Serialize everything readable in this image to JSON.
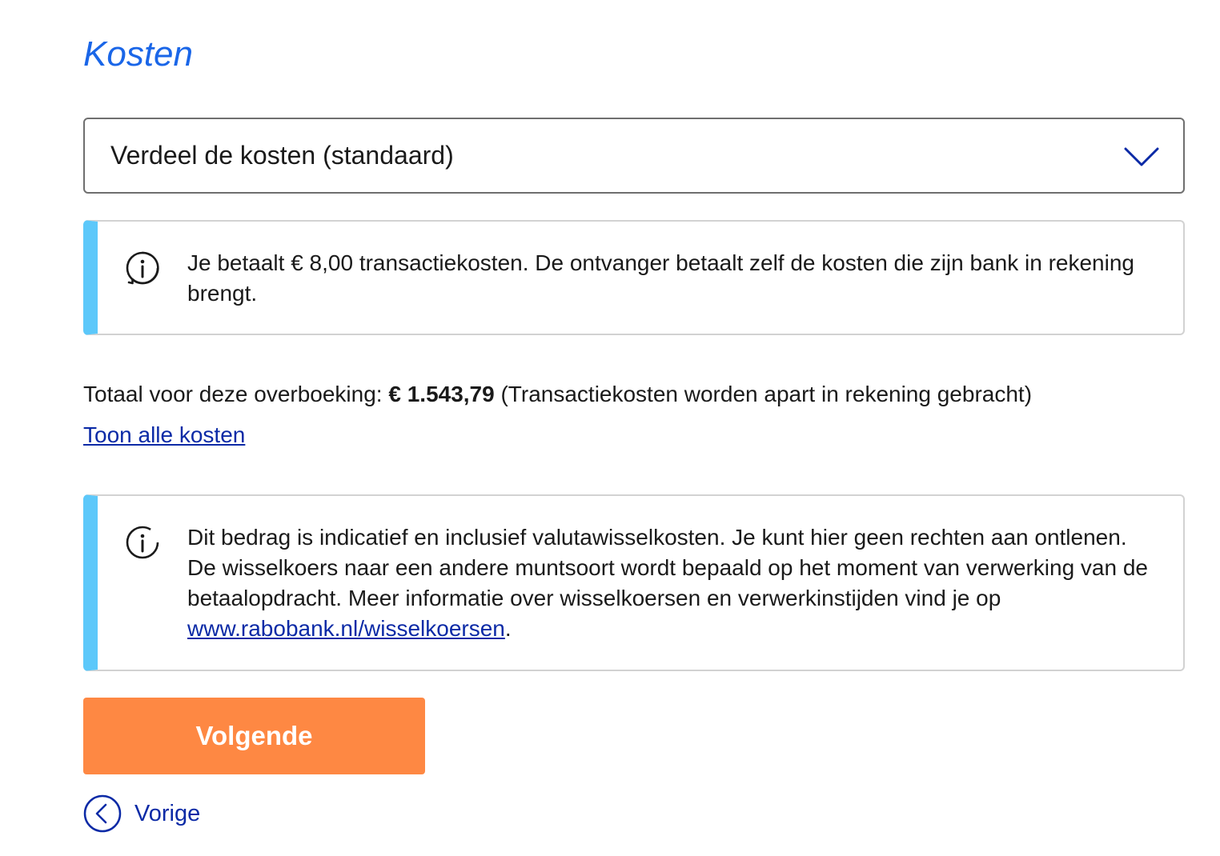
{
  "section": {
    "title": "Kosten"
  },
  "cost_select": {
    "selected": "Verdeel de kosten (standaard)"
  },
  "info_fees": {
    "text": "Je betaalt € 8,00 transactiekosten. De ontvanger betaalt zelf de kosten die zijn bank in rekening brengt."
  },
  "total": {
    "label": "Totaal voor deze overboeking: ",
    "amount": "€ 1.543,79",
    "note": " (Transactiekosten worden apart in rekening gebracht)"
  },
  "show_costs_link": "Toon alle kosten",
  "info_exchange": {
    "text_before": "Dit bedrag is indicatief en inclusief valutawisselkosten. Je kunt hier geen rechten aan ontlenen. De wisselkoers naar een andere muntsoort wordt bepaald op het moment van verwerking van de betaalopdracht. Meer informatie over wisselkoersen en verwerkinstijden vind je op ",
    "link": "www.rabobank.nl/wisselkoersen",
    "text_after": "."
  },
  "buttons": {
    "next": "Volgende",
    "previous": "Vorige"
  },
  "colors": {
    "title_blue": "#1a66e8",
    "link_blue": "#0b2aa6",
    "info_accent": "#5cc8fa",
    "primary_button": "#fe8843"
  },
  "icons": {
    "select": "chevron-down-icon",
    "info": "info-icon",
    "previous": "chevron-left-circle-icon"
  }
}
